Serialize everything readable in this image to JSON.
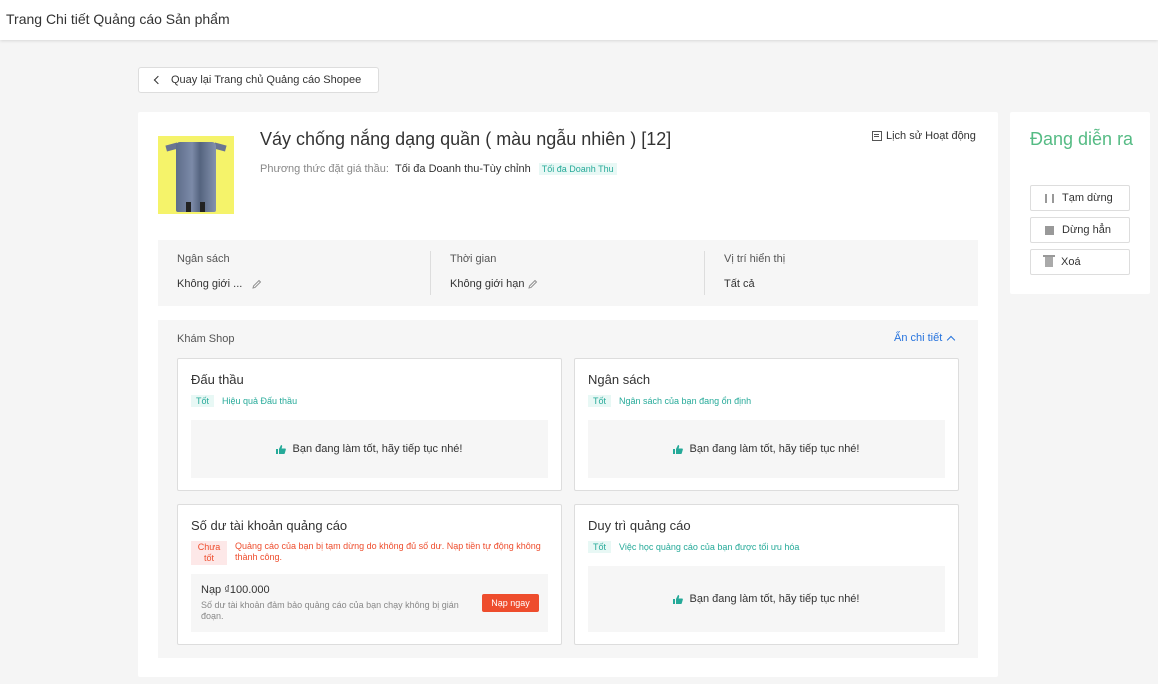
{
  "header": {
    "title": "Trang Chi tiết Quảng cáo Sản phẩm"
  },
  "back": {
    "label": "Quay lại Trang chủ Quảng cáo Shopee"
  },
  "product": {
    "name": "Váy chống nắng dạng quần ( màu ngẫu nhiên ) [12]",
    "bid_label": "Phương thức đặt giá thầu:",
    "bid_value": "Tối đa Doanh thu-Tùy chỉnh",
    "bid_tag": "Tối đa Doanh Thu",
    "history_label": "Lịch sử Hoạt động"
  },
  "stats": [
    {
      "label": "Ngân sách",
      "value": "Không giới ..."
    },
    {
      "label": "Thời gian",
      "value": "Không giới hạn"
    },
    {
      "label": "Vị trí hiển thị",
      "value": "Tất cả"
    }
  ],
  "explore": {
    "title": "Khám Shop",
    "toggle_label": "Ẩn chi tiết",
    "cards": {
      "bidding": {
        "title": "Đấu thầu",
        "badge": "Tốt",
        "desc": "Hiệu quả Đấu thầu",
        "ok": "Bạn đang làm tốt, hãy tiếp tục nhé!"
      },
      "budget": {
        "title": "Ngân sách",
        "badge": "Tốt",
        "desc": "Ngân sách của bạn đang ổn định",
        "ok": "Bạn đang làm tốt, hãy tiếp tục nhé!"
      },
      "balance": {
        "title": "Số dư tài khoản quảng cáo",
        "badge": "Chưa tốt",
        "desc": "Quảng cáo của bạn bị tạm dừng do không đủ số dư. Nạp tiền tự động không thành công.",
        "topup_title": "Nạp ₫100.000",
        "topup_desc": "Số dư tài khoản đảm bảo quảng cáo của bạn chạy không bị gián đoạn.",
        "topup_button": "Nạp ngay"
      },
      "maintain": {
        "title": "Duy trì quảng cáo",
        "badge": "Tốt",
        "desc": "Việc học quảng cáo của bạn được tối ưu hóa",
        "ok": "Bạn đang làm tốt, hãy tiếp tục nhé!"
      }
    }
  },
  "status": {
    "text": "Đang diễn ra",
    "pause": "Tạm dừng",
    "stop": "Dừng hẳn",
    "delete": "Xoá"
  },
  "colors": {
    "accent": "#ee4d2d",
    "good": "#26aa99",
    "status": "#55bb84",
    "link": "#2673dd"
  }
}
